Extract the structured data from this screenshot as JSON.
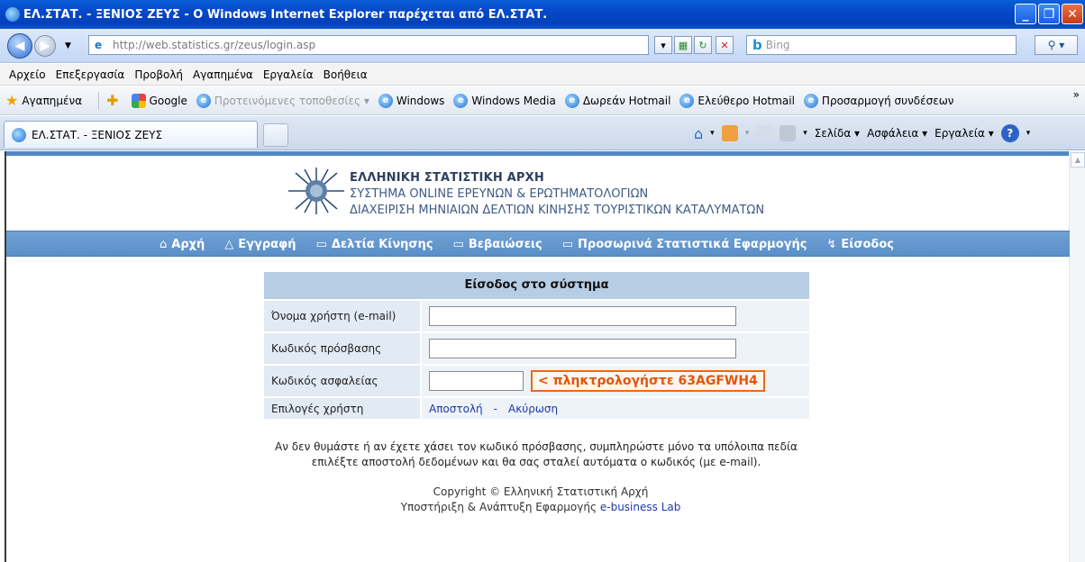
{
  "window": {
    "title": "ΕΛ.ΣΤΑΤ. - ΞΕΝΙΟΣ ΖΕΥΣ - Ο Windows Internet Explorer παρέχεται από ΕΛ.ΣΤΑΤ.",
    "minimize_icon": "minimize-icon",
    "maximize_icon": "maximize-icon",
    "close_icon": "close-icon"
  },
  "address": {
    "url_domain": "http://web.statistics.gr",
    "url_path": "/zeus/login.asp",
    "search_placeholder": "Bing"
  },
  "menu": [
    "Αρχείο",
    "Επεξεργασία",
    "Προβολή",
    "Αγαπημένα",
    "Εργαλεία",
    "Βοήθεια"
  ],
  "favorites": {
    "label": "Αγαπημένα",
    "items": [
      {
        "label": "Google",
        "grey": false
      },
      {
        "label": "Προτεινόμενες τοποθεσίες ▾",
        "grey": true
      },
      {
        "label": "Windows",
        "grey": false
      },
      {
        "label": "Windows Media",
        "grey": false
      },
      {
        "label": "Δωρεάν Hotmail",
        "grey": false
      },
      {
        "label": "Ελεύθερο Hotmail",
        "grey": false
      },
      {
        "label": "Προσαρμογή συνδέσεων",
        "grey": false
      }
    ],
    "overflow": "»"
  },
  "tab": {
    "label": "ΕΛ.ΣΤΑΤ. - ΞΕΝΙΟΣ ΖΕΥΣ"
  },
  "commands": {
    "page": "Σελίδα ▾",
    "safety": "Ασφάλεια ▾",
    "tools": "Εργαλεία ▾"
  },
  "site": {
    "org": "ΕΛΛΗΝΙΚΗ ΣΤΑΤΙΣΤΙΚΗ ΑΡΧΗ",
    "subtitle1": "ΣΥΣΤΗΜΑ ONLINE ΕΡΕΥΝΩΝ & ΕΡΩΤΗΜΑΤΟΛΟΓΙΩΝ",
    "subtitle2": "ΔΙΑΧΕΙΡΙΣΗ ΜΗΝΙΑΙΩΝ ΔΕΛΤΙΩΝ ΚΙΝΗΣΗΣ ΤΟΥΡΙΣΤΙΚΩΝ ΚΑΤΑΛΥΜΑΤΩΝ"
  },
  "nav": [
    {
      "icon": "⌂",
      "label": "Αρχή",
      "name": "home"
    },
    {
      "icon": "△",
      "label": "Εγγραφή",
      "name": "register"
    },
    {
      "icon": "▭",
      "label": "Δελτία Κίνησης",
      "name": "movement-reports"
    },
    {
      "icon": "▭",
      "label": "Βεβαιώσεις",
      "name": "certificates"
    },
    {
      "icon": "▭",
      "label": "Προσωρινά Στατιστικά Εφαρμογής",
      "name": "temporary-statistics"
    },
    {
      "icon": "↯",
      "label": "Είσοδος",
      "name": "login"
    }
  ],
  "form": {
    "caption": "Είσοδος στο σύστημα",
    "username_label": "Όνομα χρήστη (e-mail)",
    "password_label": "Κωδικός πρόσβασης",
    "security_label": "Κωδικός ασφαλείας",
    "captcha_text": "< πληκτρολογήστε 63AGFWH4",
    "options_label": "Επιλογές χρήστη",
    "send": "Αποστολή",
    "separator": "-",
    "cancel": "Ακύρωση"
  },
  "note": {
    "line1": "Αν δεν θυμάστε ή αν έχετε χάσει τον κωδικό πρόσβασης, συμπληρώστε μόνο τα υπόλοιπα πεδία",
    "line2": "επιλέξτε αποστολή δεδομένων και θα σας σταλεί αυτόματα ο κωδικός (με e-mail)."
  },
  "footer": {
    "copyright": "Copyright © Ελληνική Στατιστική Αρχή",
    "support_prefix": "Υποστήριξη & Ανάπτυξη Εφαρμογής",
    "support_link": "e-business Lab"
  }
}
